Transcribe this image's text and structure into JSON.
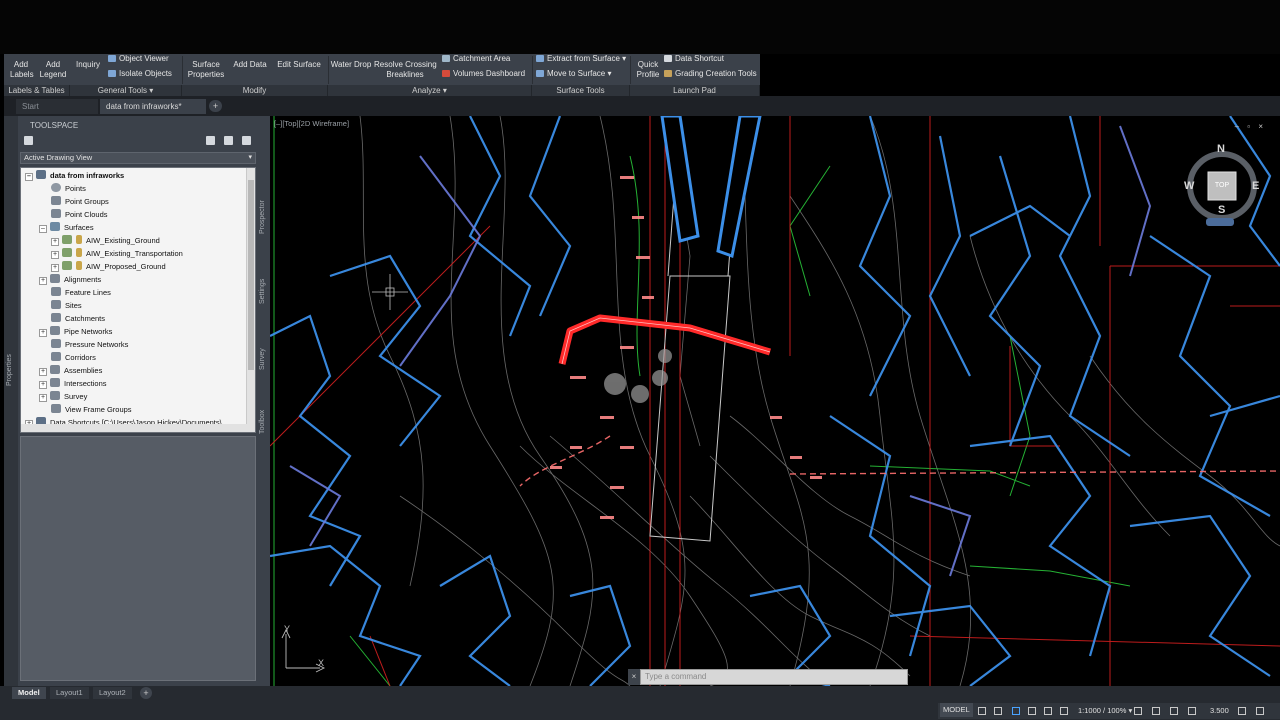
{
  "ribbon": {
    "buttons": {
      "add_labels": "Add\nLabels",
      "add_legend": "Add\nLegend",
      "inquiry": "Inquiry",
      "object_viewer": "Object Viewer",
      "isolate_objects": "Isolate Objects",
      "surface_properties": "Surface\nProperties",
      "add_data": "Add Data",
      "edit_surface": "Edit Surface",
      "water_drop": "Water Drop",
      "resolve_crossing": "Resolve Crossing\nBreaklines",
      "catchment_area": "Catchment Area",
      "volumes_dashboard": "Volumes Dashboard",
      "extract_from_surface": "Extract from Surface",
      "move_to_surface": "Move to Surface",
      "quick_profile": "Quick\nProfile",
      "data_shortcut": "Data Shortcut",
      "grading_creation_tools": "Grading Creation Tools"
    },
    "panels": {
      "labels_tables": "Labels & Tables",
      "general_tools": "General Tools ▾",
      "modify": "Modify",
      "analyze": "Analyze ▾",
      "surface_tools": "Surface Tools",
      "launch_pad": "Launch Pad"
    }
  },
  "file_tabs": {
    "start": "Start",
    "active": "data from infraworks*",
    "add": "+"
  },
  "toolspace": {
    "title": "TOOLSPACE",
    "view_select": "Active Drawing View",
    "side_tabs": [
      "Prospector",
      "Settings",
      "Survey",
      "Toolbox"
    ],
    "properties_label": "Properties",
    "tree": {
      "root": "data from infraworks",
      "points": "Points",
      "point_groups": "Point Groups",
      "point_clouds": "Point Clouds",
      "surfaces": "Surfaces",
      "surface_1": "AIW_Existing_Ground",
      "surface_2": "AIW_Existing_Transportation",
      "surface_3": "AIW_Proposed_Ground",
      "alignments": "Alignments",
      "feature_lines": "Feature Lines",
      "sites": "Sites",
      "catchments": "Catchments",
      "pipe_networks": "Pipe Networks",
      "pressure_networks": "Pressure Networks",
      "corridors": "Corridors",
      "assemblies": "Assemblies",
      "intersections": "Intersections",
      "survey": "Survey",
      "view_frame_groups": "View Frame Groups",
      "data_shortcuts": "Data Shortcuts [C:\\Users\\Jason Hickey\\Documents\\..."
    }
  },
  "viewport": {
    "label": "[–][Top][2D Wireframe]",
    "controls": "– ▫ ×",
    "viewcube": {
      "n": "N",
      "s": "S",
      "e": "E",
      "w": "W",
      "top": "TOP"
    },
    "ucs_y": "Y",
    "ucs_x": "X"
  },
  "command_line": {
    "close": "×",
    "placeholder": "Type a command"
  },
  "layout_tabs": {
    "model": "Model",
    "layout1": "Layout1",
    "layout2": "Layout2",
    "add": "+"
  },
  "status_bar": {
    "model": "MODEL",
    "scale": "1:1000 / 100% ▾",
    "value": "3.500"
  },
  "colors": {
    "ribbon_bg": "#3b414a",
    "cad_blue": "#4aa3ff",
    "cad_red": "#ff2a2a",
    "cad_green": "#2ecc40"
  }
}
